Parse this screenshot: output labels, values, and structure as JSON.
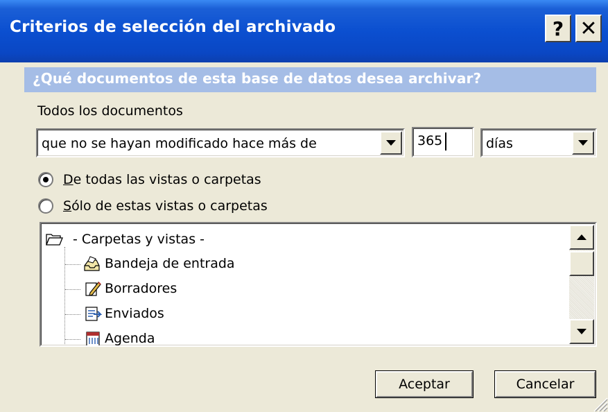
{
  "window": {
    "title": "Criterios de selección del archivado",
    "help_label": "?",
    "close_label": "✕"
  },
  "question": "¿Qué documentos de esta base de datos desea archivar?",
  "all_docs_label": "Todos los documentos",
  "condition": {
    "selected": "que no se hayan modificado hace más de",
    "amount": "365",
    "unit": "días"
  },
  "radios": {
    "all_views": {
      "label": "De todas las vistas o carpetas",
      "checked": true
    },
    "only_these": {
      "label": "Sólo de estas vistas o carpetas",
      "checked": false
    }
  },
  "tree": {
    "root": "- Carpetas y vistas -",
    "items": [
      {
        "label": "Bandeja de entrada",
        "icon": "inbox-icon"
      },
      {
        "label": "Borradores",
        "icon": "drafts-icon"
      },
      {
        "label": "Enviados",
        "icon": "sent-icon"
      },
      {
        "label": "Agenda",
        "icon": "calendar-icon"
      }
    ]
  },
  "buttons": {
    "ok": "Aceptar",
    "cancel": "Cancelar"
  }
}
